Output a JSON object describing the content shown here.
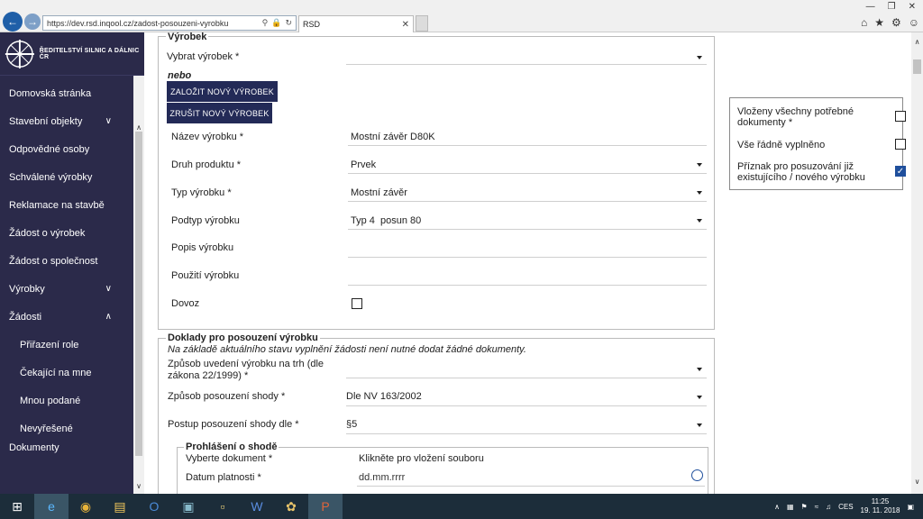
{
  "browser": {
    "url": "https://dev.rsd.inqool.cz/zadost-posouzeni-vyrobku",
    "tab_title": "RSD"
  },
  "sidebar": {
    "logo_text": "ŘEDITELSTVÍ SILNIC A DÁLNIC ČR",
    "items": [
      {
        "label": "Domovská stránka"
      },
      {
        "label": "Stavební objekty"
      },
      {
        "label": "Odpovědné osoby"
      },
      {
        "label": "Schválené výrobky"
      },
      {
        "label": "Reklamace na stavbě"
      },
      {
        "label": "Žádost o výrobek"
      },
      {
        "label": "Žádost o společnost"
      },
      {
        "label": "Výrobky"
      },
      {
        "label": "Žádosti"
      }
    ],
    "subitems": [
      {
        "label": "Přiřazení role"
      },
      {
        "label": "Čekající na mne"
      },
      {
        "label": "Mnou podané"
      },
      {
        "label": "Nevyřešené"
      }
    ],
    "cut_item": "Dokumenty"
  },
  "vyrobek": {
    "legend": "Výrobek",
    "select_label": "Vybrat výrobek *",
    "or_text": "nebo",
    "create_button": "ZALOŽIT NOVÝ VÝROBEK",
    "cancel_button": "ZRUŠIT NOVÝ VÝROBEK",
    "fields": {
      "nazev_label": "Název výrobku *",
      "nazev_value": "Mostní závěr D80K",
      "druh_label": "Druh produktu *",
      "druh_value": "Prvek",
      "typ_label": "Typ výrobku *",
      "typ_value": "Mostní závěr",
      "podtyp_label": "Podtyp výrobku",
      "podtyp_value": "Typ 4  posun 80",
      "popis_label": "Popis výrobku",
      "pouziti_label": "Použití výrobku",
      "dovoz_label": "Dovoz"
    }
  },
  "doklady": {
    "legend": "Doklady pro posouzení výrobku",
    "note": "Na základě aktuálního stavu vyplnění žádosti není nutné dodat žádné dokumenty.",
    "zpusob_uvedeni_label": "Způsob uvedení výrobku na trh (dle zákona 22/1999) *",
    "zpusob_posouzeni_label": "Způsob posouzení shody *",
    "zpusob_posouzeni_value": "Dle NV 163/2002",
    "postup_label": "Postup posouzení shody dle *",
    "postup_value": "§5",
    "prohlaseni": {
      "legend": "Prohlášení o shodě",
      "doc_label": "Vyberte dokument *",
      "doc_value": "Klikněte pro vložení souboru",
      "datum_label": "Datum platnosti *",
      "datum_placeholder": "dd.mm.rrrr"
    }
  },
  "checklist": {
    "items": [
      {
        "label": "Vloženy všechny potřebné dokumenty *",
        "checked": false
      },
      {
        "label": "Vše řádně vyplněno",
        "checked": false
      },
      {
        "label": "Příznak pro posuzování již existujícího / nového výrobku",
        "checked": true
      }
    ]
  },
  "taskbar": {
    "lang": "CES",
    "time": "11:25",
    "date": "19. 11. 2018"
  },
  "colors": {
    "sidebar_bg": "#2b2a4a",
    "button_bg": "#232a57",
    "checkbox_on": "#1f4f9c"
  }
}
